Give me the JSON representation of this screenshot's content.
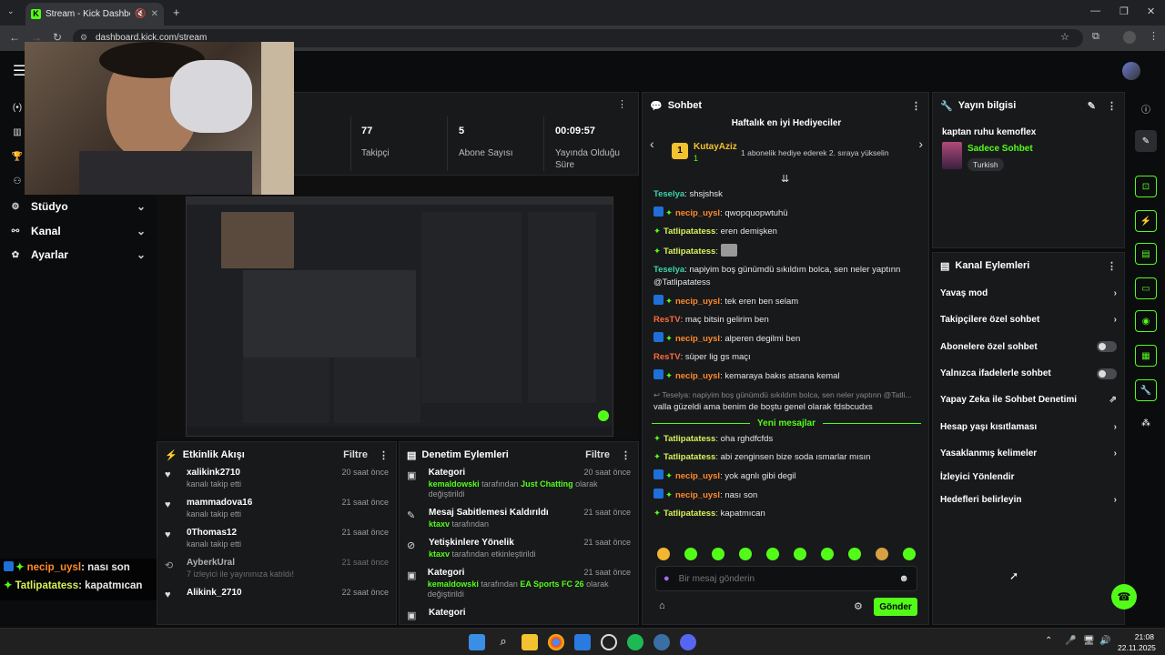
{
  "browser": {
    "tab_title": "Stream - Kick Dashboard",
    "new_tab": "+",
    "url": "dashboard.kick.com/stream"
  },
  "colors": {
    "accent": "#53fc18",
    "panel": "#18191b",
    "bg": "#0b0c0e"
  },
  "sidebar": {
    "items": [
      {
        "label": "Stüdyo",
        "icon": "studio-icon"
      },
      {
        "label": "Kanal",
        "icon": "channel-icon"
      },
      {
        "label": "Ayarlar",
        "icon": "gear-icon"
      }
    ]
  },
  "stats": [
    {
      "value": "77",
      "label": "Takipçi"
    },
    {
      "value": "5",
      "label": "Abone Sayısı"
    },
    {
      "value": "00:09:57",
      "label": "Yayında Olduğu Süre"
    }
  ],
  "activity": {
    "title": "Etkinlik Akışı",
    "filter": "Filtre",
    "items": [
      {
        "name": "xalikink2710",
        "sub": "kanalı takip etti",
        "time": "20 saat önce"
      },
      {
        "name": "mammadova16",
        "sub": "kanalı takip etti",
        "time": "21 saat önce"
      },
      {
        "name": "0Thomas12",
        "sub": "kanalı takip etti",
        "time": "21 saat önce"
      },
      {
        "name": "AyberkUral",
        "sub": "7 izleyici ile yayınınıza katıldı!",
        "time": "21 saat önce"
      },
      {
        "name": "Alikink_2710",
        "sub": "",
        "time": "22 saat önce"
      }
    ]
  },
  "moderation": {
    "title": "Denetim Eylemleri",
    "filter": "Filtre",
    "items": [
      {
        "name": "Kategori",
        "user": "kemaldowski",
        "mid": " tarafından ",
        "hl": "Just Chatting",
        "tail": " olarak değiştirildi",
        "time": "20 saat önce"
      },
      {
        "name": "Mesaj Sabitlemesi Kaldırıldı",
        "user": "ktaxv",
        "mid": " tarafından",
        "hl": "",
        "tail": "",
        "time": "21 saat önce"
      },
      {
        "name": "Yetişkinlere Yönelik",
        "user": "ktaxv",
        "mid": " tarafından etkinleştirildi",
        "hl": "",
        "tail": "",
        "time": "21 saat önce"
      },
      {
        "name": "Kategori",
        "user": "kemaldowski",
        "mid": " tarafından ",
        "hl": "EA Sports FC 26",
        "tail": " olarak değiştirildi",
        "time": "21 saat önce"
      },
      {
        "name": "Kategori",
        "user": "",
        "mid": "",
        "hl": "",
        "tail": "",
        "time": ""
      }
    ]
  },
  "chat": {
    "title": "Sohbet",
    "gifters_title": "Haftalık en iyi Hediyeciler",
    "gifter_rank": "1",
    "gifter_name": "KutayAziz",
    "gifter_count": "1",
    "gifter_hint": "1 abonelik hediye ederek 2. sıraya yükselin",
    "messages": [
      {
        "user": "Teselya",
        "cls": "u-t",
        "badges": 0,
        "text": "shsjshsk"
      },
      {
        "user": "necip_uysl",
        "cls": "u-o",
        "badges": 2,
        "text": "qwopquopwtuhü"
      },
      {
        "user": "Tatlipatatess",
        "cls": "u-y",
        "badges": 1,
        "text": "eren demişken"
      },
      {
        "user": "Tatlipatatess",
        "cls": "u-y",
        "badges": 1,
        "text": "[emote]"
      },
      {
        "user": "Teselya",
        "cls": "u-t",
        "badges": 0,
        "text": "napiyim boş günümdü sıkıldım bolca, sen neler yaptınn @Tatlipatatess"
      },
      {
        "user": "necip_uysl",
        "cls": "u-o",
        "badges": 2,
        "text": "tek eren ben selam"
      },
      {
        "user": "ResTV",
        "cls": "u-r",
        "badges": 0,
        "text": "maç bitsin gelirim ben"
      },
      {
        "user": "necip_uysl",
        "cls": "u-o",
        "badges": 2,
        "text": "alperen degilmi ben"
      },
      {
        "user": "ResTV",
        "cls": "u-r",
        "badges": 0,
        "text": "süper lig gs maçı"
      },
      {
        "user": "necip_uysl",
        "cls": "u-o",
        "badges": 2,
        "text": "kemaraya bakıs atsana kemal"
      }
    ],
    "reply_ref": "↩ Teselya: napiyim boş günümdü sıkıldım bolca, sen neler yaptınn @Tatli...",
    "reply_text": "valla güzeldi ama benim de boştu genel olarak fdsbcudxs",
    "reply_user": "Tatlipatatess",
    "new_messages": "Yeni mesajlar",
    "new": [
      {
        "user": "Tatlipatatess",
        "cls": "u-y",
        "badges": 1,
        "text": "oha rghdfcfds"
      },
      {
        "user": "Tatlipatatess",
        "cls": "u-y",
        "badges": 1,
        "text": "abi zenginsen bize soda ısmarlar mısın"
      },
      {
        "user": "necip_uysl",
        "cls": "u-o",
        "badges": 2,
        "text": "yok agnlı gibi degil"
      },
      {
        "user": "necip_uysl",
        "cls": "u-o",
        "badges": 2,
        "text": "nası son"
      },
      {
        "user": "Tatlipatatess",
        "cls": "u-y",
        "badges": 1,
        "text": "kapatmıcan"
      }
    ],
    "placeholder": "Bir mesaj gönderin",
    "send": "Gönder"
  },
  "stream_info": {
    "title": "Yayın bilgisi",
    "stream_title": "kaptan ruhu kemoflex",
    "category": "Sadece Sohbet",
    "tag": "Turkish"
  },
  "channel_actions": {
    "title": "Kanal Eylemleri",
    "items": [
      {
        "label": "Yavaş mod",
        "type": "chevron"
      },
      {
        "label": "Takipçilere özel sohbet",
        "type": "chevron"
      },
      {
        "label": "Abonelere özel sohbet",
        "type": "toggle"
      },
      {
        "label": "Yalnızca ifadelerle sohbet",
        "type": "toggle"
      },
      {
        "label": "Yapay Zeka ile Sohbet Denetimi",
        "type": "external"
      },
      {
        "label": "Hesap yaşı kısıtlaması",
        "type": "chevron"
      },
      {
        "label": "Yasaklanmış kelimeler",
        "type": "chevron"
      },
      {
        "label": "İzleyici Yönlendir",
        "type": "none"
      },
      {
        "label": "Hedefleri belirleyin",
        "type": "chevron"
      }
    ]
  },
  "overlay_chat": [
    {
      "user": "necip_uysl",
      "text": ": nası son"
    },
    {
      "user": "Tatlipatatess",
      "text": ": kapatmıcan"
    }
  ],
  "taskbar": {
    "time": "21:08",
    "date": "22.11.2025"
  }
}
